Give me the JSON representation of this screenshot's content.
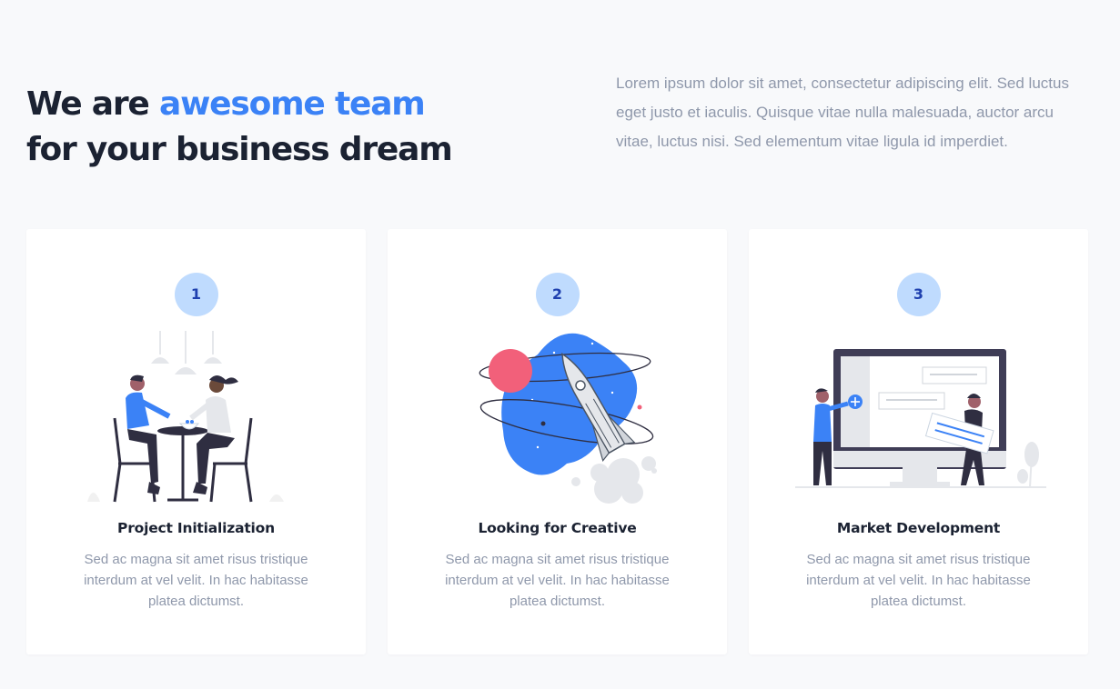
{
  "hero": {
    "prefix": "We are ",
    "accent": "awesome team",
    "line2": "for your business dream"
  },
  "intro": "Lorem ipsum dolor sit amet, consectetur adipiscing elit. Sed luctus eget justo et iaculis. Quisque vitae nulla malesuada, auctor arcu vitae, luctus nisi. Sed elementum vitae ligula id imperdiet.",
  "colors": {
    "accent": "#3b82f6",
    "heading": "#1b2232",
    "muted": "#8f98ab",
    "badge_bg": "#bfdbfe",
    "badge_text": "#1e40af",
    "pink": "#f2607a"
  },
  "cards": [
    {
      "number": "1",
      "icon": "people-meeting-illustration",
      "title": "Project Initialization",
      "description": "Sed ac magna sit amet risus tristique interdum at vel velit. In hac habitasse platea dictumst."
    },
    {
      "number": "2",
      "icon": "rocket-launch-illustration",
      "title": "Looking for Creative",
      "description": "Sed ac magna sit amet risus tristique interdum at vel velit. In hac habitasse platea dictumst."
    },
    {
      "number": "3",
      "icon": "monitor-presentation-illustration",
      "title": "Market Development",
      "description": "Sed ac magna sit amet risus tristique interdum at vel velit. In hac habitasse platea dictumst."
    }
  ]
}
